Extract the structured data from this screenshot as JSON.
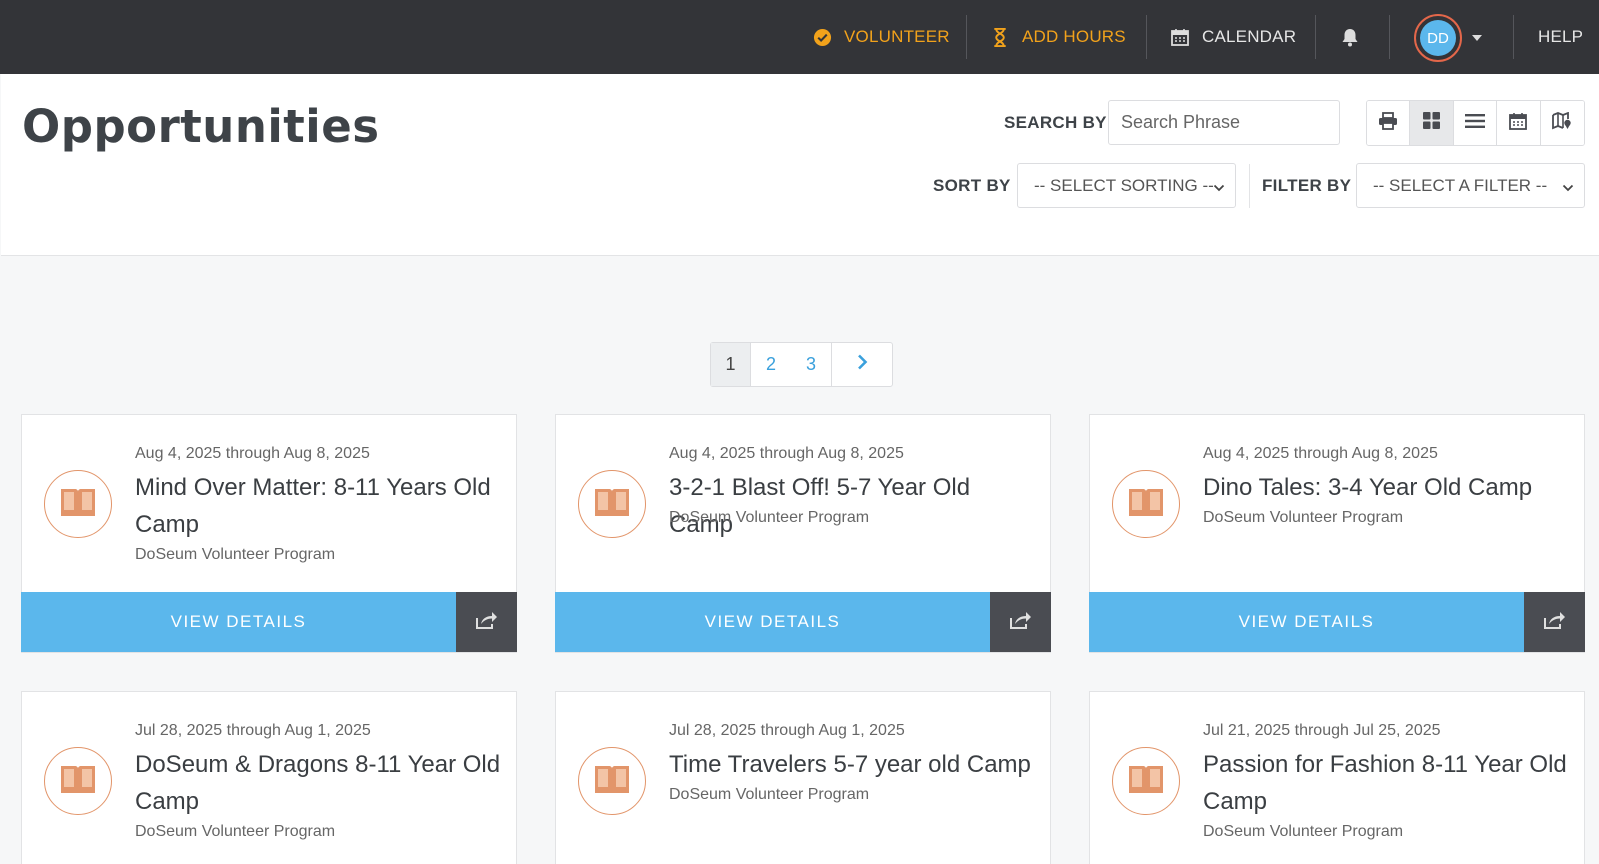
{
  "nav": {
    "volunteer": "VOLUNTEER",
    "add_hours": "ADD HOURS",
    "calendar": "CALENDAR",
    "avatar_initials": "DD",
    "help": "HELP"
  },
  "page": {
    "title": "Opportunities",
    "search_label": "SEARCH BY",
    "search_placeholder": "Search Phrase",
    "sort_label": "SORT BY",
    "sort_value": "-- SELECT SORTING --",
    "filter_label": "FILTER BY",
    "filter_value": "-- SELECT A FILTER --",
    "view_modes": [
      "print-icon",
      "grid-icon",
      "list-icon",
      "calendar-icon",
      "map-icon"
    ],
    "active_view": "grid-icon"
  },
  "pagination": {
    "pages": [
      "1",
      "2",
      "3"
    ],
    "current": "1",
    "next_icon": "chevron-right-icon"
  },
  "cards": [
    {
      "date": "Aug 4, 2025 through Aug 8, 2025",
      "title": "Mind Over Matter: 8-11 Years Old Camp",
      "org": "DoSeum Volunteer Program",
      "action": "VIEW DETAILS"
    },
    {
      "date": "Aug 4, 2025 through Aug 8, 2025",
      "title": "3-2-1 Blast Off! 5-7 Year Old Camp",
      "org": "DoSeum Volunteer Program",
      "action": "VIEW DETAILS"
    },
    {
      "date": "Aug 4, 2025 through Aug 8, 2025",
      "title": "Dino Tales: 3-4 Year Old Camp",
      "org": "DoSeum Volunteer Program",
      "action": "VIEW DETAILS"
    },
    {
      "date": "Jul 28, 2025 through Aug 1, 2025",
      "title": "DoSeum & Dragons 8-11 Year Old Camp",
      "org": "DoSeum Volunteer Program",
      "action": ""
    },
    {
      "date": "Jul 28, 2025 through Aug 1, 2025",
      "title": "Time Travelers 5-7 year old Camp",
      "org": "DoSeum Volunteer Program",
      "action": ""
    },
    {
      "date": "Jul 21, 2025 through Jul 25, 2025",
      "title": "Passion for Fashion 8-11 Year Old Camp",
      "org": "DoSeum Volunteer Program",
      "action": ""
    }
  ],
  "colors": {
    "topbar": "#333438",
    "accent_orange": "#f2a21b",
    "button_blue": "#5bb7ec",
    "share_dark": "#4a4c52",
    "emblem": "#e2956a"
  }
}
